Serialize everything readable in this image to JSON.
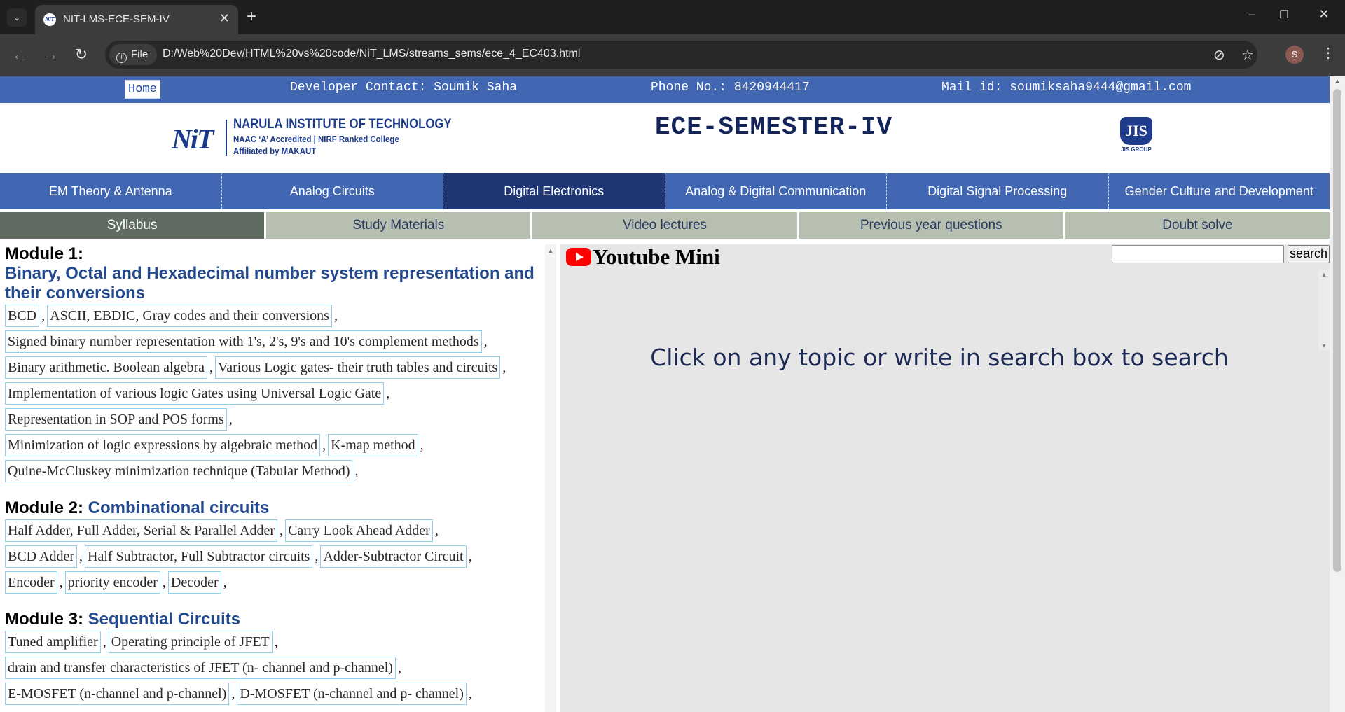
{
  "browser": {
    "tab_title": "NIT-LMS-ECE-SEM-IV",
    "tab_favicon_text": "NiT",
    "file_label": "File",
    "url": "D:/Web%20Dev/HTML%20vs%20code/NiT_LMS/streams_sems/ece_4_EC403.html",
    "profile_initial": "S"
  },
  "topstrip": {
    "home": "Home",
    "developer": "Developer Contact: Soumik Saha",
    "phone": "Phone No.: 8420944417",
    "mail": "Mail id: soumiksaha9444@gmail.com"
  },
  "header": {
    "nit_mark": "NiT",
    "nit_name": "NARULA INSTITUTE OF TECHNOLOGY",
    "nit_line2": "NAAC ‘A’ Accredited | NIRF Ranked College",
    "nit_line3": "Affiliated by MAKAUT",
    "title": "ECE-SEMESTER-IV",
    "jis_mark": "JIS",
    "jis_text": "JIS GROUP"
  },
  "subjects": [
    "EM Theory & Antenna",
    "Analog Circuits",
    "Digital Electronics",
    "Analog & Digital Communication",
    "Digital Signal Processing",
    "Gender Culture and Development"
  ],
  "subtabs": [
    "Syllabus",
    "Study Materials",
    "Video lectures",
    "Previous year questions",
    "Doubt solve"
  ],
  "syllabus": {
    "module1": {
      "label": "Module 1:",
      "topic": "Binary, Octal and Hexadecimal number system representation and their conversions",
      "lines": [
        [
          "BCD",
          "ASCII, EBDIC, Gray codes and their conversions"
        ],
        [
          "Signed binary number representation with 1's, 2's, 9's and 10's complement methods"
        ],
        [
          "Binary arithmetic. Boolean algebra",
          "Various Logic gates- their truth tables and circuits"
        ],
        [
          "Implementation of various logic Gates using Universal Logic Gate"
        ],
        [
          "Representation in SOP and POS forms"
        ],
        [
          "Minimization of logic expressions by algebraic method",
          "K-map method"
        ],
        [
          "Quine-McCluskey minimization technique (Tabular Method)"
        ]
      ]
    },
    "module2": {
      "label": "Module 2:",
      "topic": "Combinational circuits",
      "lines": [
        [
          "Half Adder, Full Adder, Serial & Parallel Adder",
          "Carry Look Ahead Adder"
        ],
        [
          "BCD Adder",
          "Half Subtractor, Full Subtractor circuits",
          "Adder-Subtractor Circuit"
        ],
        [
          "Encoder",
          "priority encoder",
          "Decoder"
        ]
      ]
    },
    "module3": {
      "label": "Module 3:",
      "topic": "Sequential Circuits",
      "lines": [
        [
          "Tuned amplifier",
          "Operating principle of JFET"
        ],
        [
          "drain and transfer characteristics of JFET (n- channel and p-channel)"
        ],
        [
          "E-MOSFET (n-channel and p-channel)",
          "D-MOSFET (n-channel and p- channel)"
        ]
      ]
    }
  },
  "youtube": {
    "title": "Youtube Mini",
    "search_value": "",
    "search_button": "search",
    "message": "Click on any topic or write in search box to search"
  }
}
